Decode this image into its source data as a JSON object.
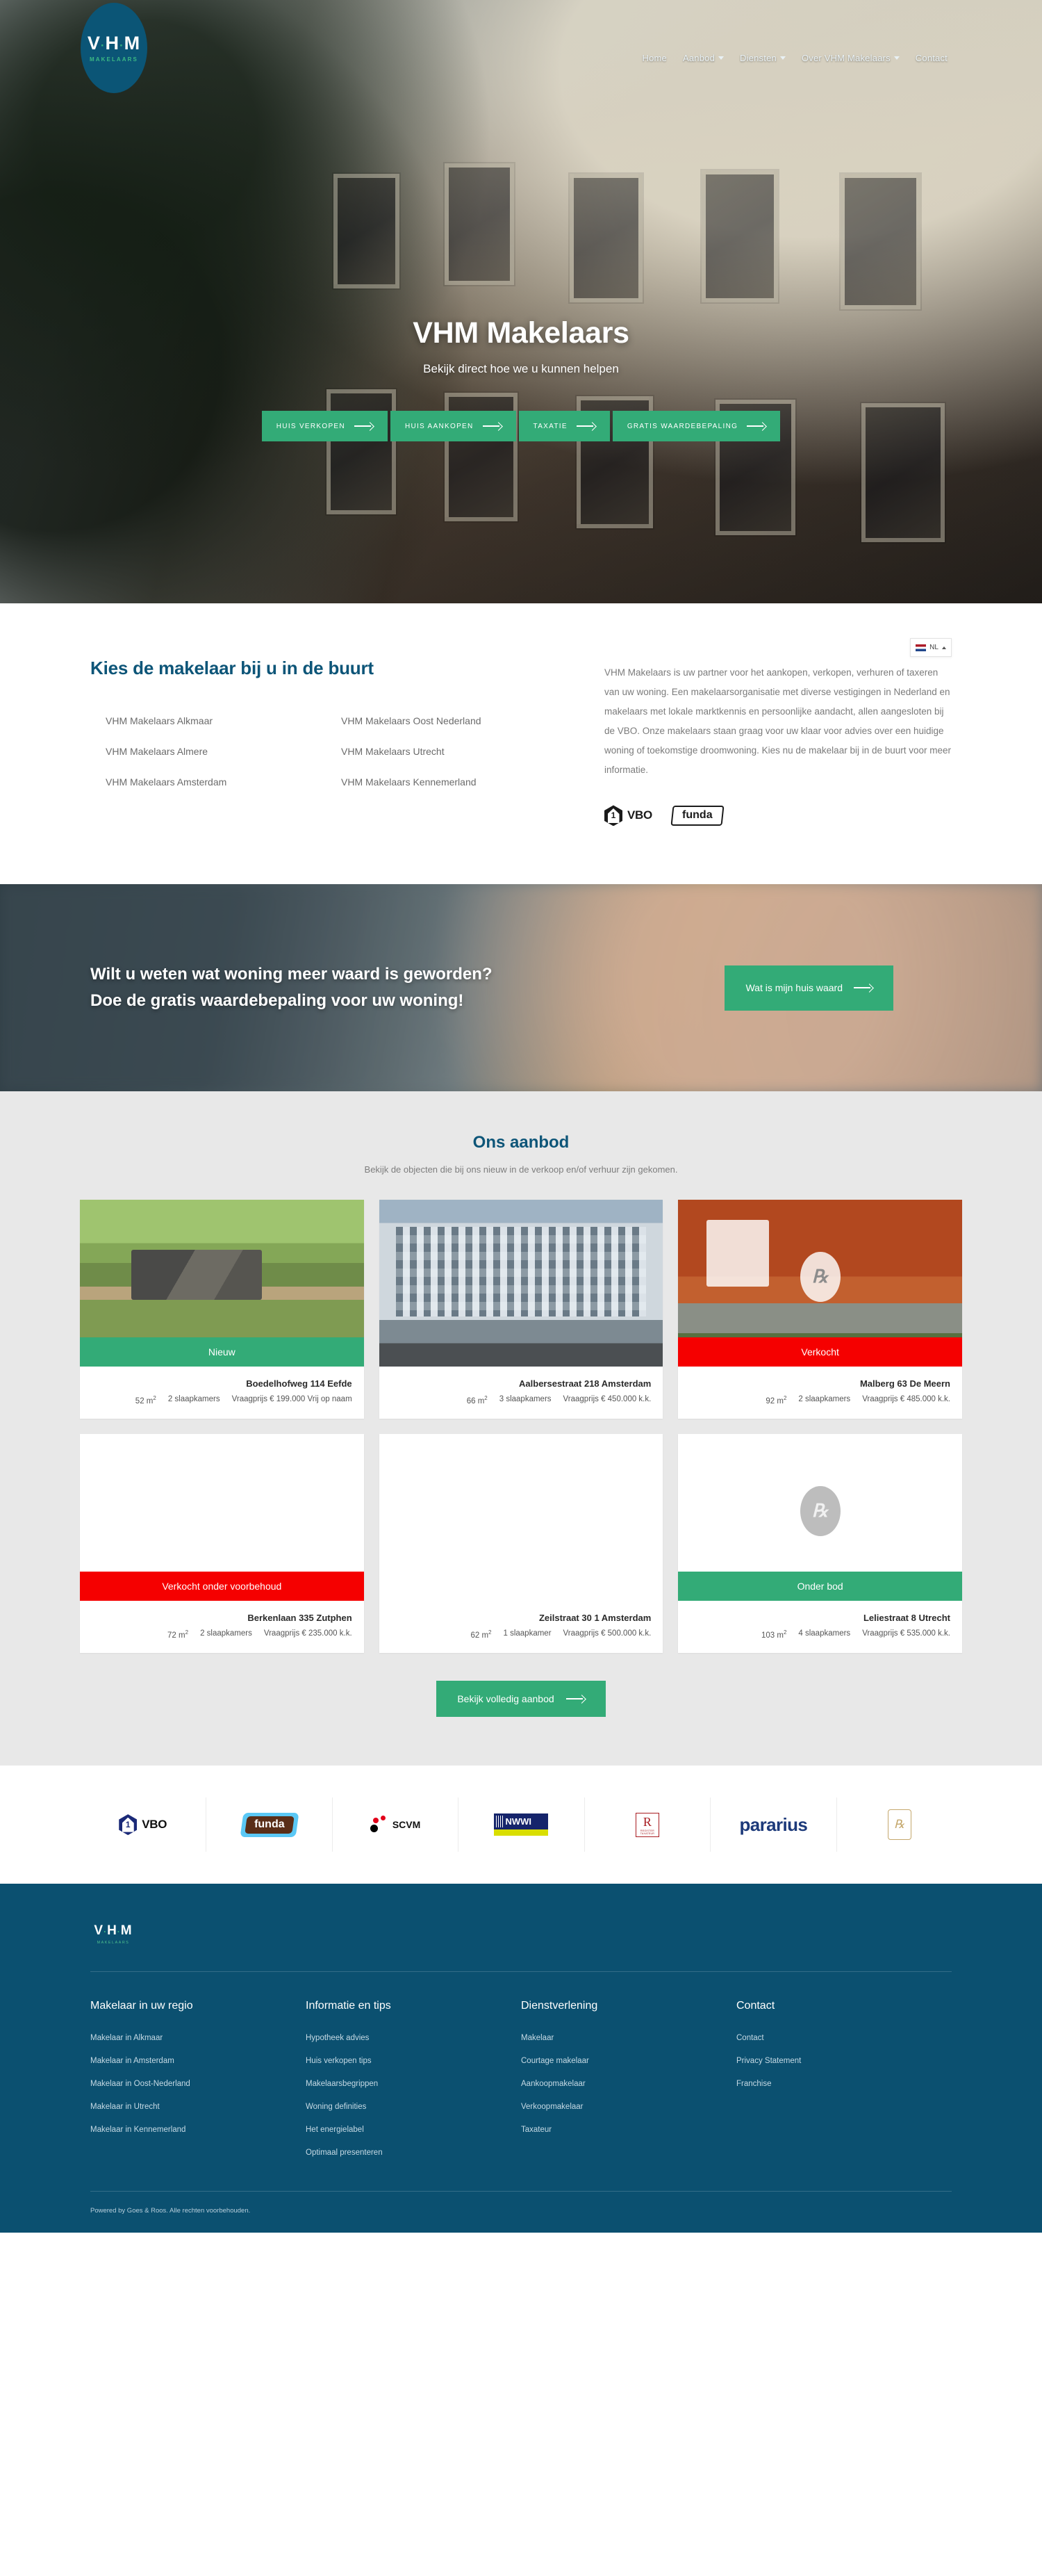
{
  "brand": {
    "logo_main": "VHM",
    "logo_sub": "MAKELAARS",
    "footer_logo_main": "VHM",
    "footer_logo_sub": "MAKELAARS",
    "accent_green": "#33ab77",
    "brand_blue": "#0b5070",
    "sold_red": "#f50000"
  },
  "nav": {
    "items": [
      {
        "label": "Home",
        "has_dropdown": false
      },
      {
        "label": "Aanbod",
        "has_dropdown": true
      },
      {
        "label": "Diensten",
        "has_dropdown": true
      },
      {
        "label": "Over VHM Makelaars",
        "has_dropdown": true
      },
      {
        "label": "Contact",
        "has_dropdown": false
      }
    ]
  },
  "hero": {
    "title": "VHM Makelaars",
    "subtitle": "Bekijk direct hoe we u kunnen helpen",
    "buttons": [
      {
        "label": "HUIS VERKOPEN"
      },
      {
        "label": "HUIS AANKOPEN"
      },
      {
        "label": "TAXATIE"
      },
      {
        "label": "GRATIS WAARDEBEPALING"
      }
    ]
  },
  "offices": {
    "heading": "Kies de makelaar bij u in de buurt",
    "items": [
      "VHM Makelaars Alkmaar",
      "VHM Makelaars Oost Nederland",
      "VHM Makelaars Almere",
      "VHM Makelaars Utrecht",
      "VHM Makelaars Amsterdam",
      "VHM Makelaars Kennemerland"
    ],
    "intro": "VHM Makelaars is uw partner voor het aankopen, verkopen, verhuren of taxeren van uw woning. Een makelaarsorganisatie met diverse vestigingen in Nederland en makelaars met lokale marktkennis en persoonlijke aandacht, allen aangesloten bij de VBO. Onze makelaars staan graag voor uw klaar voor advies over een huidige woning of toekomstige droomwoning. Kies nu de makelaar bij in de buurt voor meer informatie.",
    "cert_vbo": "VBO",
    "cert_funda": "funda"
  },
  "language": {
    "code": "NL"
  },
  "cta": {
    "text": "Wilt u weten wat woning meer waard is geworden? Doe de gratis waardebepaling voor uw woning!",
    "button": "Wat is mijn huis waard"
  },
  "aanbod": {
    "heading": "Ons aanbod",
    "lead": "Bekijk de objecten die bij ons nieuw in de verkoop en/of verhuur zijn gekomen.",
    "button": "Bekijk volledig aanbod",
    "cards": [
      {
        "badge": "Nieuw",
        "badge_type": "green",
        "media": "aerial",
        "title": "Boedelhofweg 114 Eefde",
        "area": "52 m",
        "rooms": "2 slaapkamers",
        "price": "Vraagprijs € 199.000 Vrij op naam"
      },
      {
        "badge": "",
        "badge_type": "none",
        "media": "apartment",
        "title": "Aalbersestraat 218 Amsterdam",
        "area": "66 m",
        "rooms": "3 slaapkamers",
        "price": "Vraagprijs € 450.000 k.k."
      },
      {
        "badge": "Verkocht",
        "badge_type": "red",
        "media": "brick",
        "title": "Malberg 63 De Meern",
        "area": "92 m",
        "rooms": "2 slaapkamers",
        "price": "Vraagprijs € 485.000 k.k."
      },
      {
        "badge": "Verkocht onder voorbehoud",
        "badge_type": "red",
        "media": "blank",
        "title": "Berkenlaan 335 Zutphen",
        "area": "72 m",
        "rooms": "2 slaapkamers",
        "price": "Vraagprijs € 235.000 k.k."
      },
      {
        "badge": "",
        "badge_type": "none",
        "media": "blank",
        "title": "Zeilstraat 30 1 Amsterdam",
        "area": "62 m",
        "rooms": "1 slaapkamer",
        "price": "Vraagprijs € 500.000 k.k."
      },
      {
        "badge": "Onder bod",
        "badge_type": "green",
        "media": "blank-watermark",
        "title": "Leliestraat 8 Utrecht",
        "area": "103 m",
        "rooms": "4 slaapkamers",
        "price": "Vraagprijs € 535.000 k.k."
      }
    ]
  },
  "partners": [
    {
      "name": "VBO",
      "kind": "vbo"
    },
    {
      "name": "funda",
      "kind": "funda"
    },
    {
      "name": "SCVM",
      "kind": "scvm"
    },
    {
      "name": "NWWI",
      "kind": "nwwi"
    },
    {
      "name": "Register Taxateur",
      "kind": "register-taxateur",
      "line1": "R",
      "line2": "REGISTER TAXATEUR"
    },
    {
      "name": "pararius",
      "kind": "pararius"
    },
    {
      "name": "Taxateur keurmerk",
      "kind": "gold-seal"
    }
  ],
  "footer": {
    "columns": [
      {
        "title": "Makelaar in uw regio",
        "links": [
          "Makelaar in Alkmaar",
          "Makelaar in Amsterdam",
          "Makelaar in Oost-Nederland",
          "Makelaar in Utrecht",
          "Makelaar in Kennemerland"
        ]
      },
      {
        "title": "Informatie en tips",
        "links": [
          "Hypotheek advies",
          "Huis verkopen tips",
          "Makelaarsbegrippen",
          "Woning definities",
          "Het energielabel",
          "Optimaal presenteren"
        ]
      },
      {
        "title": "Dienstverlening",
        "links": [
          "Makelaar",
          "Courtage makelaar",
          "Aankoopmakelaar",
          "Verkoopmakelaar",
          "Taxateur"
        ]
      },
      {
        "title": "Contact",
        "links": [
          "Contact",
          "Privacy Statement",
          "Franchise"
        ]
      }
    ],
    "copyright": "Powered by Goes & Roos. Alle rechten voorbehouden."
  }
}
